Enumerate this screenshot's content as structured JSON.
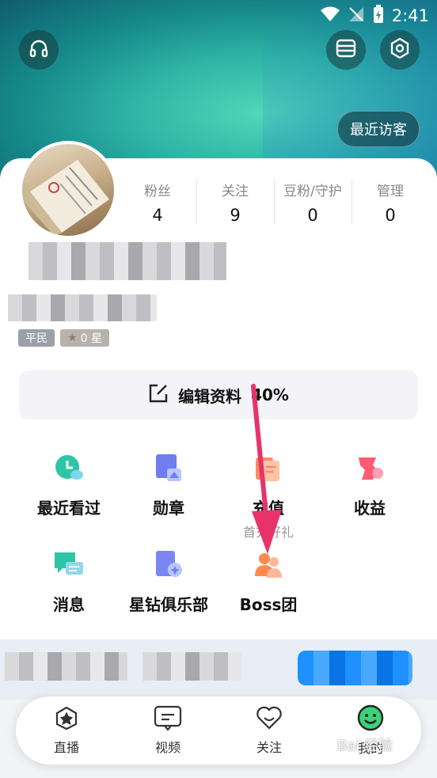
{
  "status_bar": {
    "time": "2:41"
  },
  "header": {
    "visitor_button": "最近访客"
  },
  "stats": [
    {
      "label": "粉丝",
      "value": "4"
    },
    {
      "label": "关注",
      "value": "9"
    },
    {
      "label": "豆粉/守护",
      "value": "0"
    },
    {
      "label": "管理",
      "value": "0"
    }
  ],
  "badges": {
    "level": "平民",
    "star": "0 星"
  },
  "edit_profile": {
    "label": "编辑资料",
    "progress": "40%"
  },
  "grid": [
    {
      "label": "最近看过",
      "icon": "clock-icon"
    },
    {
      "label": "勋章",
      "icon": "medal-icon"
    },
    {
      "label": "充值",
      "sub": "首充好礼",
      "icon": "recharge-icon"
    },
    {
      "label": "收益",
      "icon": "income-icon"
    },
    {
      "label": "消息",
      "icon": "message-icon"
    },
    {
      "label": "星钻俱乐部",
      "icon": "diamond-club-icon"
    },
    {
      "label": "Boss团",
      "icon": "boss-group-icon"
    }
  ],
  "tabs": [
    {
      "label": "直播",
      "icon": "live-icon"
    },
    {
      "label": "视频",
      "icon": "video-icon"
    },
    {
      "label": "关注",
      "icon": "heart-icon"
    },
    {
      "label": "我的",
      "icon": "smile-icon"
    }
  ],
  "watermark": "Bai 经验",
  "colors": {
    "accent": "#e8336a",
    "mine_tab": "#3ad27a",
    "hero": "#2fb4a6"
  }
}
